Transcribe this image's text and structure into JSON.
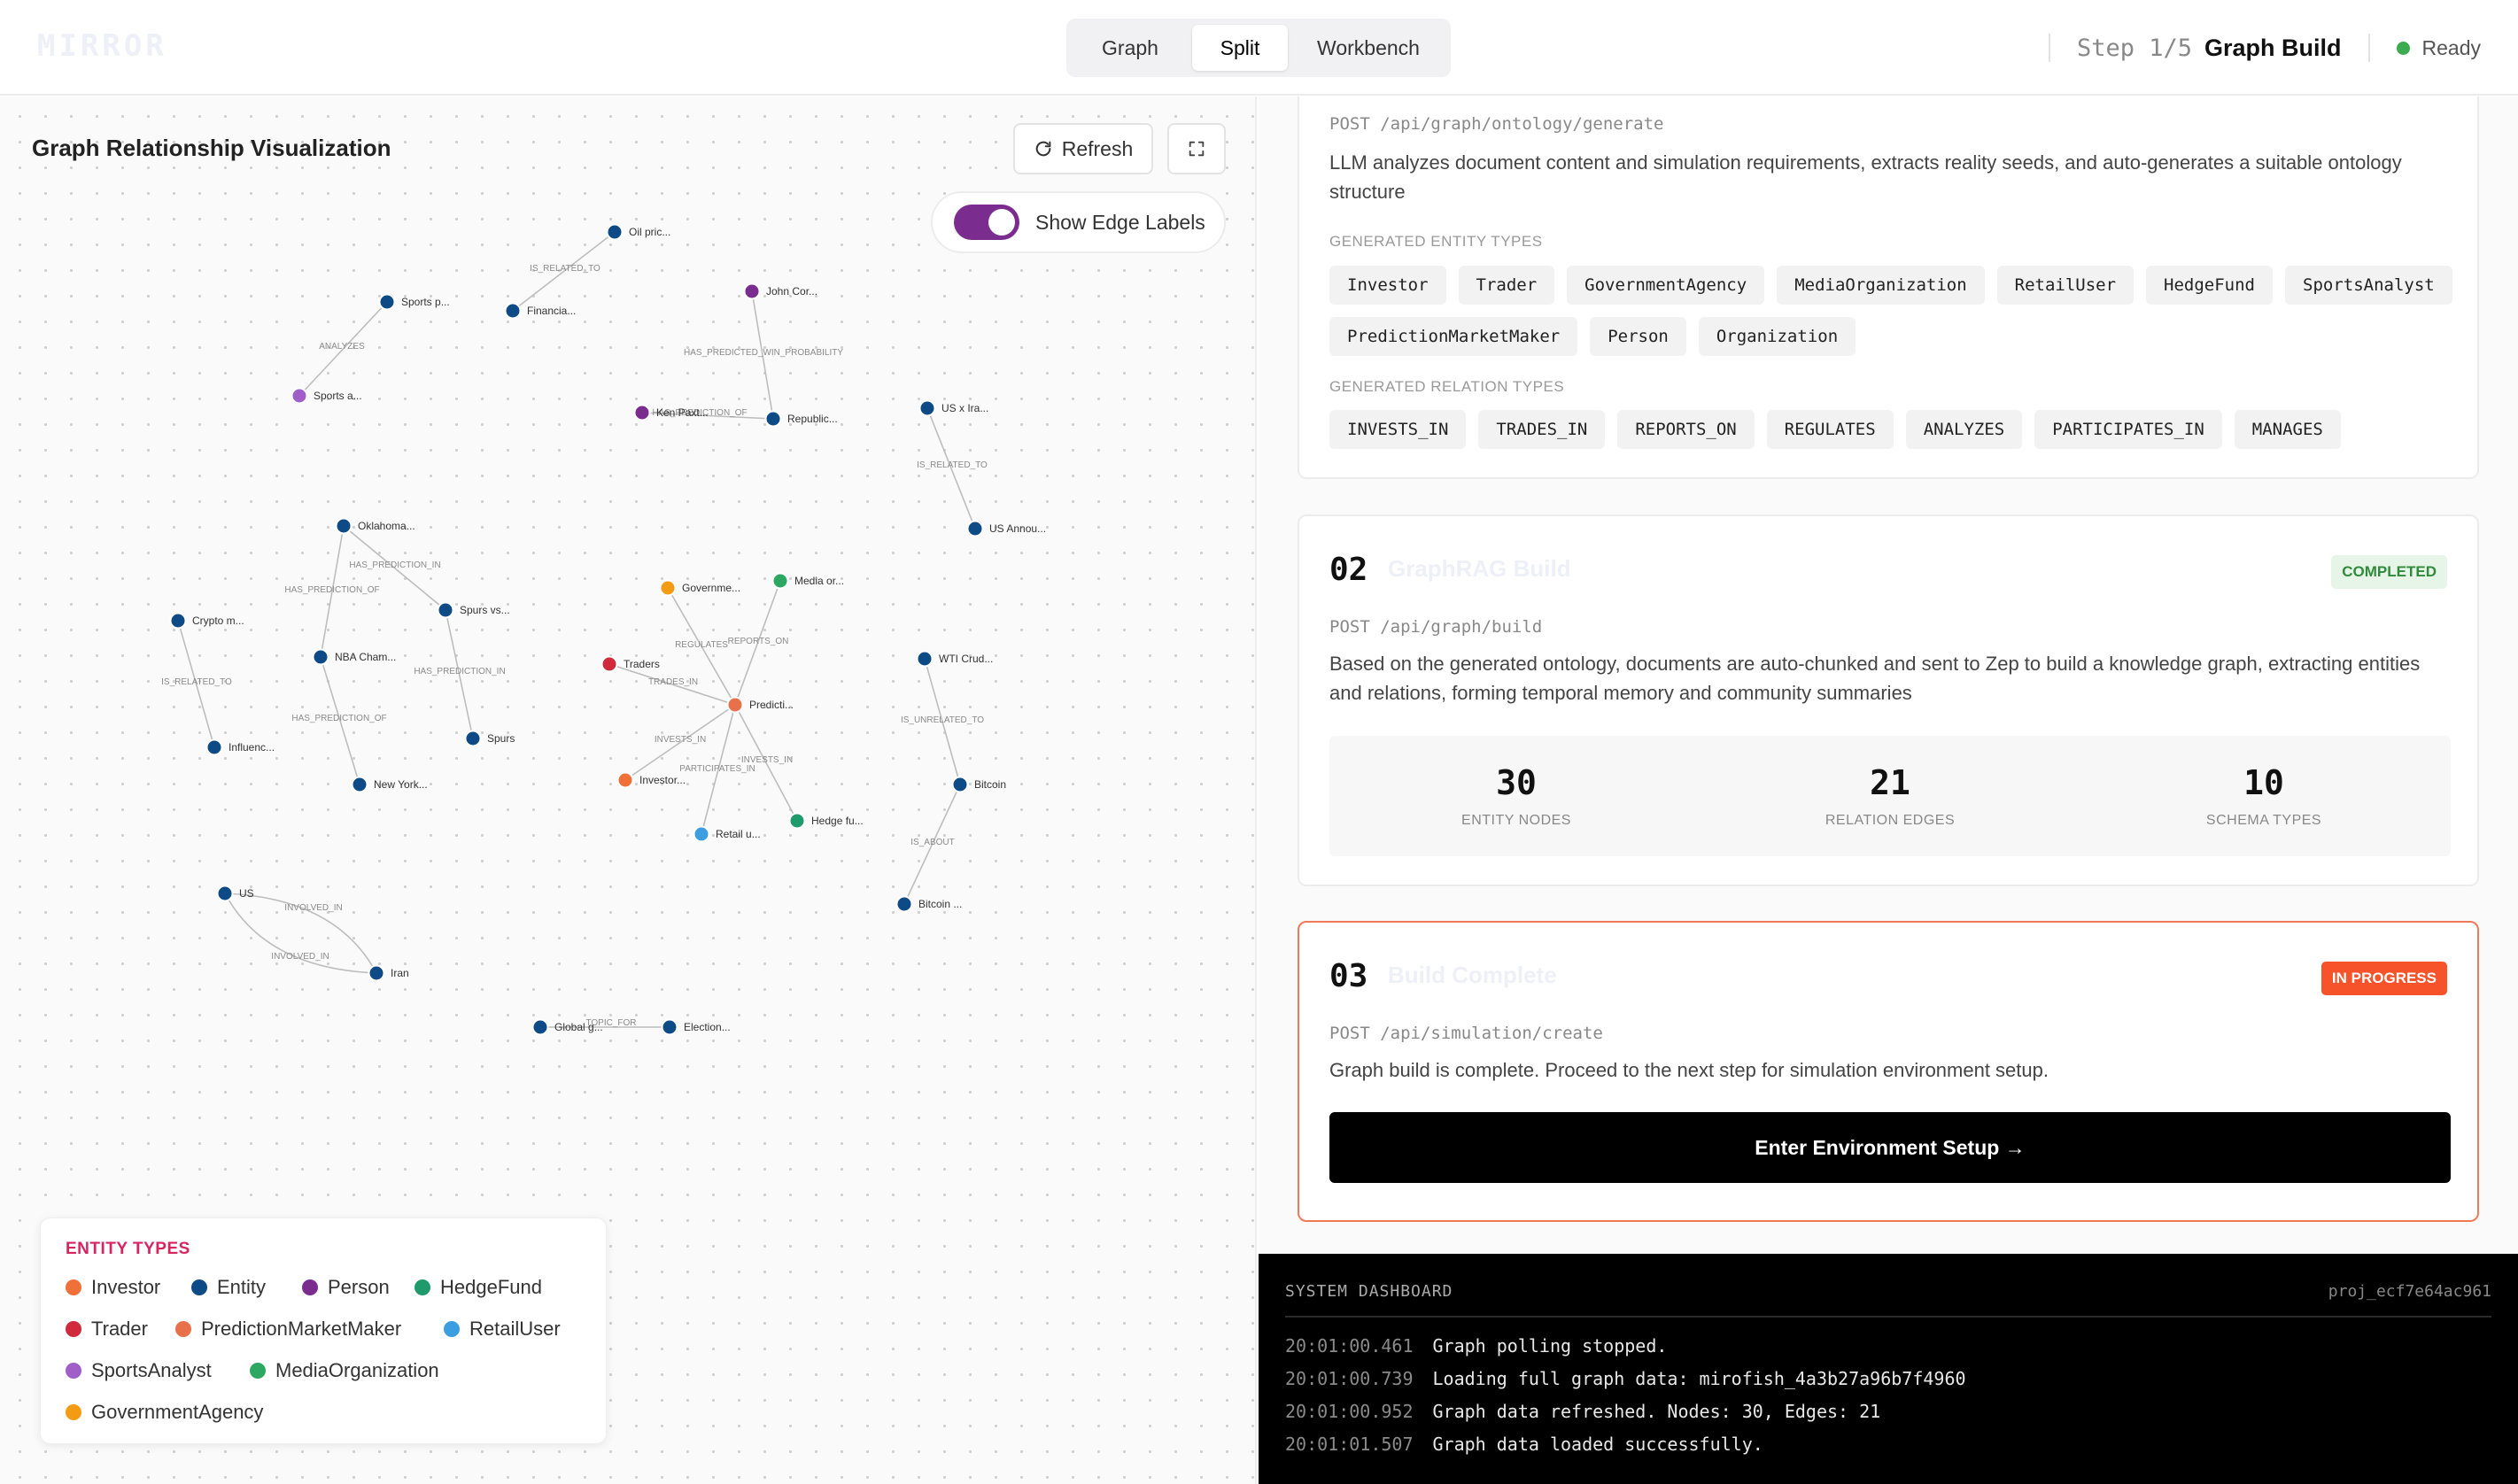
{
  "header": {
    "logo": "MIRROR",
    "views": [
      "Graph",
      "Split",
      "Workbench"
    ],
    "active_view": "Split",
    "step_label": "Step 1/5",
    "step_name": "Graph Build",
    "status": "Ready",
    "status_color": "#3dab4f"
  },
  "graph_panel": {
    "title": "Graph Relationship Visualization",
    "refresh_label": "Refresh",
    "edge_labels_toggle": "Show Edge Labels",
    "edge_labels_on": true,
    "nodes": [
      {
        "label": "Oil pric...",
        "type": "Entity"
      },
      {
        "label": "Financia...",
        "type": "Entity"
      },
      {
        "label": "Sports p...",
        "type": "Entity"
      },
      {
        "label": "Sports a...",
        "type": "SportsAnalyst"
      },
      {
        "label": "John Cor...",
        "type": "Person"
      },
      {
        "label": "Ken Paxt...",
        "type": "Person"
      },
      {
        "label": "Republic...",
        "type": "Entity"
      },
      {
        "label": "US x Ira...",
        "type": "Entity"
      },
      {
        "label": "US Annou...",
        "type": "Entity"
      },
      {
        "label": "Oklahoma...",
        "type": "Entity"
      },
      {
        "label": "Spurs vs...",
        "type": "Entity"
      },
      {
        "label": "Crypto m...",
        "type": "Entity"
      },
      {
        "label": "NBA Cham...",
        "type": "Entity"
      },
      {
        "label": "Influenc...",
        "type": "Entity"
      },
      {
        "label": "New York...",
        "type": "Entity"
      },
      {
        "label": "Spurs",
        "type": "Entity"
      },
      {
        "label": "Governme...",
        "type": "GovernmentAgency"
      },
      {
        "label": "Media or...",
        "type": "MediaOrganization"
      },
      {
        "label": "Traders",
        "type": "Trader"
      },
      {
        "label": "Predicti...",
        "type": "PredictionMarketMaker"
      },
      {
        "label": "Investor...",
        "type": "Investor"
      },
      {
        "label": "Retail u...",
        "type": "RetailUser"
      },
      {
        "label": "Hedge fu...",
        "type": "HedgeFund"
      },
      {
        "label": "WTI Crud...",
        "type": "Entity"
      },
      {
        "label": "Bitcoin",
        "type": "Entity"
      },
      {
        "label": "Bitcoin ...",
        "type": "Entity"
      },
      {
        "label": "US",
        "type": "Entity"
      },
      {
        "label": "Iran",
        "type": "Entity"
      },
      {
        "label": "Global g...",
        "type": "Entity"
      },
      {
        "label": "Election...",
        "type": "Entity"
      }
    ],
    "edges": [
      {
        "source": 0,
        "target": 1,
        "label": "IS_RELATED_TO"
      },
      {
        "source": 2,
        "target": 3,
        "label": "ANALYZES"
      },
      {
        "source": 4,
        "target": 6,
        "label": "HAS_PREDICTED_WIN_PROBABILITY"
      },
      {
        "source": 5,
        "target": 6,
        "label": "HAS_PREDICTION_OF"
      },
      {
        "source": 7,
        "target": 8,
        "label": "IS_RELATED_TO"
      },
      {
        "source": 9,
        "target": 10,
        "label": "HAS_PREDICTION_IN"
      },
      {
        "source": 9,
        "target": 12,
        "label": "HAS_PREDICTION_OF"
      },
      {
        "source": 10,
        "target": 15,
        "label": "HAS_PREDICTION_IN"
      },
      {
        "source": 11,
        "target": 13,
        "label": "IS_RELATED_TO"
      },
      {
        "source": 12,
        "target": 14,
        "label": "HAS_PREDICTION_OF"
      },
      {
        "source": 16,
        "target": 19,
        "label": "REGULATES"
      },
      {
        "source": 17,
        "target": 19,
        "label": "REPORTS_ON"
      },
      {
        "source": 18,
        "target": 19,
        "label": "TRADES_IN"
      },
      {
        "source": 20,
        "target": 19,
        "label": "INVESTS_IN"
      },
      {
        "source": 21,
        "target": 19,
        "label": "PARTICIPATES_IN"
      },
      {
        "source": 22,
        "target": 19,
        "label": "INVESTS_IN"
      },
      {
        "source": 23,
        "target": 24,
        "label": "IS_UNRELATED_TO"
      },
      {
        "source": 25,
        "target": 24,
        "label": "IS_ABOUT"
      },
      {
        "source": 26,
        "target": 27,
        "label": "INVOLVED_IN"
      },
      {
        "source": 27,
        "target": 26,
        "label": "INVOLVED_IN"
      },
      {
        "source": 28,
        "target": 29,
        "label": "TOPIC_FOR"
      }
    ]
  },
  "legend": {
    "title": "ENTITY TYPES",
    "items": [
      {
        "name": "Investor",
        "color": "#f0703a"
      },
      {
        "name": "Entity",
        "color": "#0d4a86"
      },
      {
        "name": "Person",
        "color": "#7b2c8f"
      },
      {
        "name": "HedgeFund",
        "color": "#1f9a6b"
      },
      {
        "name": "Trader",
        "color": "#d12a3c"
      },
      {
        "name": "PredictionMarketMaker",
        "color": "#e8704b"
      },
      {
        "name": "RetailUser",
        "color": "#3b9ee0"
      },
      {
        "name": "SportsAnalyst",
        "color": "#a05fc8"
      },
      {
        "name": "MediaOrganization",
        "color": "#2ca863"
      },
      {
        "name": "GovernmentAgency",
        "color": "#f29b13"
      }
    ]
  },
  "steps": {
    "ontology": {
      "api": "POST /api/graph/ontology/generate",
      "description": "LLM analyzes document content and simulation requirements, extracts reality seeds, and auto-generates a suitable ontology structure",
      "entity_types_label": "GENERATED ENTITY TYPES",
      "entity_types": [
        "Investor",
        "Trader",
        "GovernmentAgency",
        "MediaOrganization",
        "RetailUser",
        "HedgeFund",
        "SportsAnalyst",
        "PredictionMarketMaker",
        "Person",
        "Organization"
      ],
      "relation_types_label": "GENERATED RELATION TYPES",
      "relation_types": [
        "INVESTS_IN",
        "TRADES_IN",
        "REPORTS_ON",
        "REGULATES",
        "ANALYZES",
        "PARTICIPATES_IN",
        "MANAGES"
      ]
    },
    "graphrag": {
      "number": "02",
      "title": "GraphRAG Build",
      "badge": "COMPLETED",
      "api": "POST /api/graph/build",
      "description": "Based on the generated ontology, documents are auto-chunked and sent to Zep to build a knowledge graph, extracting entities and relations, forming temporal memory and community summaries",
      "stats": [
        {
          "value": "30",
          "label": "ENTITY NODES"
        },
        {
          "value": "21",
          "label": "RELATION EDGES"
        },
        {
          "value": "10",
          "label": "SCHEMA TYPES"
        }
      ]
    },
    "complete": {
      "number": "03",
      "title": "Build Complete",
      "badge": "IN PROGRESS",
      "api": "POST /api/simulation/create",
      "description": "Graph build is complete. Proceed to the next step for simulation environment setup.",
      "cta": "Enter Environment Setup →"
    }
  },
  "dashboard": {
    "title": "SYSTEM DASHBOARD",
    "project_id": "proj_ecf7e64ac961",
    "logs": [
      {
        "time": "20:01:00.461",
        "message": "Graph polling stopped."
      },
      {
        "time": "20:01:00.739",
        "message": "Loading full graph data: mirofish_4a3b27a96b7f4960"
      },
      {
        "time": "20:01:00.952",
        "message": "Graph data refreshed. Nodes: 30, Edges: 21"
      },
      {
        "time": "20:01:01.507",
        "message": "Graph data loaded successfully."
      }
    ]
  }
}
